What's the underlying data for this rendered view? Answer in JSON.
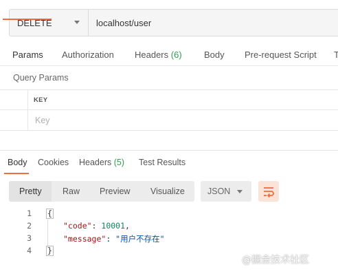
{
  "request": {
    "method": "DELETE",
    "url": "localhost/user"
  },
  "request_tabs": [
    {
      "label": "Params",
      "active": true
    },
    {
      "label": "Authorization"
    },
    {
      "label": "Headers",
      "count": "(6)"
    },
    {
      "label": "Body"
    },
    {
      "label": "Pre-request Script"
    },
    {
      "label": "T"
    }
  ],
  "params": {
    "section_label": "Query Params",
    "key_header": "KEY",
    "key_placeholder": "Key"
  },
  "response_tabs": [
    {
      "label": "Body",
      "active": true
    },
    {
      "label": "Cookies"
    },
    {
      "label": "Headers",
      "count": "(5)"
    },
    {
      "label": "Test Results"
    }
  ],
  "format": {
    "modes": [
      "Pretty",
      "Raw",
      "Preview",
      "Visualize"
    ],
    "active_mode": "Pretty",
    "language": "JSON",
    "wrap_icon": "wrap-lines-icon"
  },
  "code": {
    "line_numbers": [
      "1",
      "2",
      "3",
      "4"
    ],
    "open_brace": "{",
    "close_brace": "}",
    "fields": [
      {
        "key": "\"code\"",
        "value": "10001",
        "type": "number",
        "suffix": ","
      },
      {
        "key": "\"message\"",
        "value": "\"用户不存在\"",
        "type": "string",
        "suffix": ""
      }
    ]
  },
  "watermark": "@掘金技术社区",
  "colors": {
    "accent": "#f26b3a",
    "count_green": "#2e9e4f",
    "json_key": "#a31515",
    "json_number": "#098658",
    "json_string": "#0451a5"
  }
}
